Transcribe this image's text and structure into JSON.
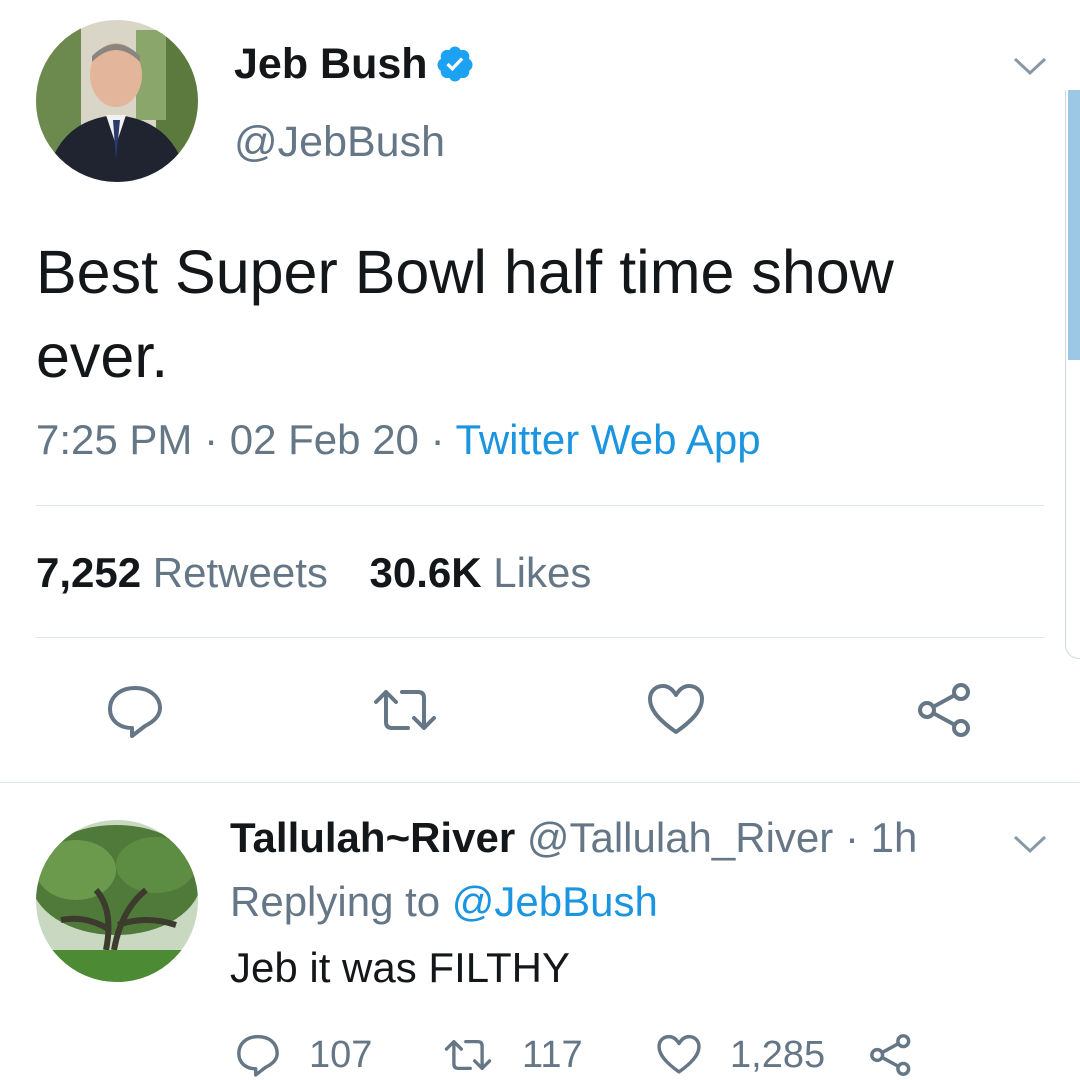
{
  "tweet": {
    "author_name": "Jeb Bush",
    "handle": "@JebBush",
    "text": "Best Super Bowl half time show ever.",
    "time": "7:25 PM",
    "separator": "·",
    "date": "02 Feb 20",
    "source": "Twitter Web App",
    "retweets_count": "7,252",
    "retweets_label": "Retweets",
    "likes_count": "30.6K",
    "likes_label": "Likes"
  },
  "reply": {
    "author_name": "Tallulah~River",
    "handle": "@Tallulah_River",
    "age": "1h",
    "replying_label": "Replying to",
    "replying_to": "@JebBush",
    "text": "Jeb it was FILTHY",
    "reply_count": "107",
    "retweet_count": "117",
    "like_count": "1,285"
  },
  "icons": {
    "verified": "verified-badge-icon",
    "more": "chevron-down-icon",
    "reply": "comment-icon",
    "retweet": "retweet-icon",
    "like": "heart-icon",
    "share": "share-icon"
  },
  "colors": {
    "link": "#1b95e0",
    "secondary_text": "#657786",
    "icon": "#657786"
  }
}
